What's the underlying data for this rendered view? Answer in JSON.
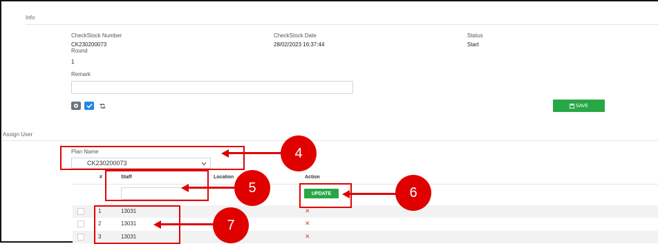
{
  "info": {
    "section_title": "Info",
    "checkstock_number_label": "CheckStock Number",
    "checkstock_number": "CK230200073",
    "checkstock_date_label": "CheckStock Date",
    "checkstock_date": "28/02/2023 16:37:44",
    "status_label": "Status",
    "status": "Start",
    "round_label": "Round",
    "round": "1",
    "remark_label": "Remark",
    "remark_value": ""
  },
  "toolbar": {
    "save_label": "SAVE"
  },
  "assign": {
    "section_title": "Assign User",
    "plan_name_label": "Plan Name",
    "plan_name": "CK230200073",
    "columns": [
      "#",
      "Staff",
      "Location",
      "Action"
    ],
    "update_label": "UPDATE",
    "rows": [
      {
        "no": "1",
        "staff": "13031"
      },
      {
        "no": "2",
        "staff": "13031"
      },
      {
        "no": "3",
        "staff": "13031"
      }
    ]
  },
  "callouts": [
    "4",
    "5",
    "6",
    "7"
  ],
  "colors": {
    "accent_green": "#28a745",
    "annotation_red": "#e00000",
    "primary_blue": "#1e88e5",
    "dark_button": "#6c757d"
  }
}
